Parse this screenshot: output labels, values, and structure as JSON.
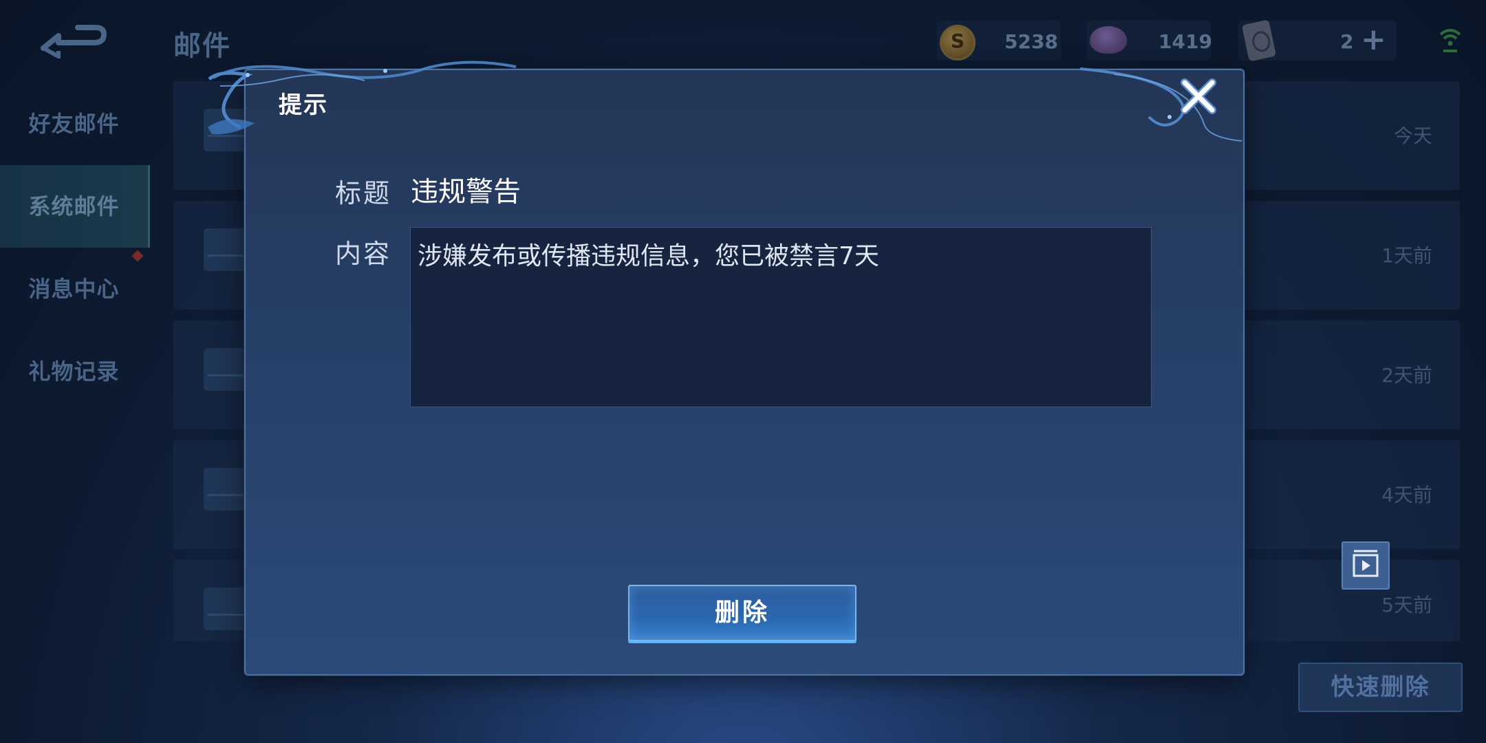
{
  "header": {
    "title": "邮件",
    "resources": [
      {
        "icon": "coin-icon",
        "value": "5238"
      },
      {
        "icon": "gem-icon",
        "value": "1419"
      },
      {
        "icon": "card-icon",
        "value": "2"
      }
    ]
  },
  "sidebar": {
    "items": [
      {
        "label": "好友邮件",
        "active": false
      },
      {
        "label": "系统邮件",
        "active": true
      },
      {
        "label": "消息中心",
        "active": false
      },
      {
        "label": "礼物记录",
        "active": false
      }
    ]
  },
  "mail_list": [
    {
      "time": "今天"
    },
    {
      "time": "1天前"
    },
    {
      "time": "2天前"
    },
    {
      "time": "4天前"
    },
    {
      "time": "5天前"
    }
  ],
  "quick_delete_label": "快速删除",
  "modal": {
    "title": "提示",
    "subject_label": "标题",
    "subject": "违规警告",
    "content_label": "内容",
    "content": "涉嫌发布或传播违规信息，您已被禁言7天",
    "delete_label": "删除"
  },
  "colors": {
    "modal_bg": "#27426c",
    "accent_button": "#2b68b0",
    "content_box": "#16243f"
  }
}
